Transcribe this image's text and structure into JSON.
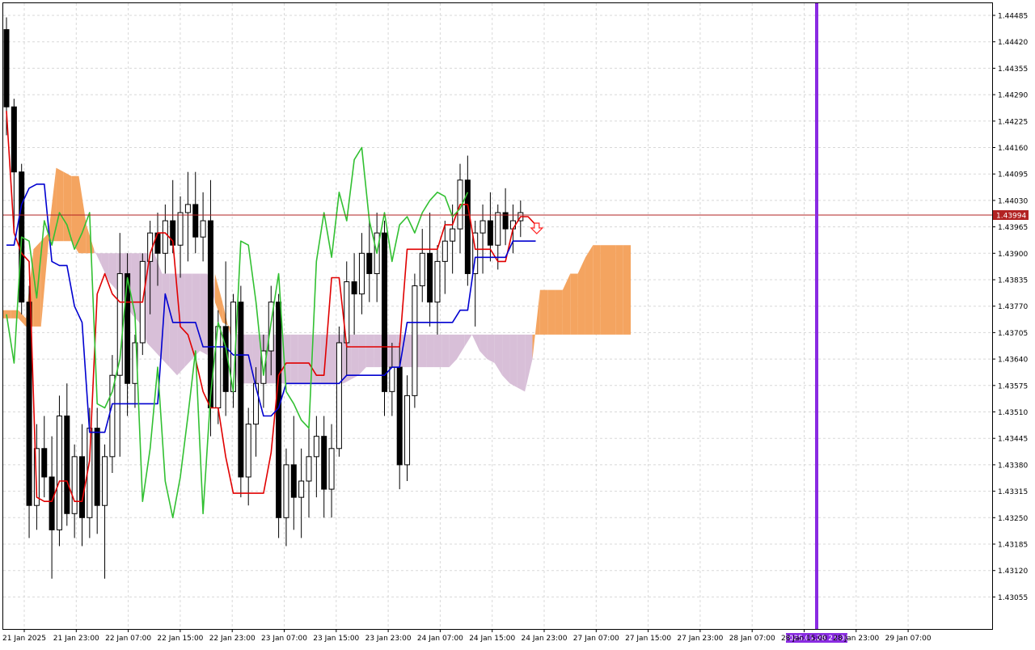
{
  "chart_data": {
    "type": "candlestick",
    "indicator": "Ichimoku Kinko Hyo",
    "y_ticks": [
      "1.44485",
      "1.44420",
      "1.44355",
      "1.44290",
      "1.44225",
      "1.44160",
      "1.44095",
      "1.44030",
      "1.43965",
      "1.43900",
      "1.43835",
      "1.43770",
      "1.43705",
      "1.43640",
      "1.43575",
      "1.43510",
      "1.43445",
      "1.43380",
      "1.43315",
      "1.43250",
      "1.43185",
      "1.43120",
      "1.43055"
    ],
    "ylim": [
      1.43004,
      1.44532
    ],
    "x_labels": [
      "21 Jan 2025",
      "21 Jan 23:00",
      "22 Jan 07:00",
      "22 Jan 15:00",
      "22 Jan 23:00",
      "23 Jan 07:00",
      "23 Jan 15:00",
      "23 Jan 23:00",
      "24 Jan 07:00",
      "24 Jan 15:00",
      "24 Jan 23:00",
      "27 Jan 07:00",
      "27 Jan 15:00",
      "27 Jan 23:00",
      "28 Jan 07:00",
      "28 Jan 15:00",
      "28 Jan 23:00",
      "29 Jan 07:00"
    ],
    "current_price": "1.43994",
    "current_price_value": 1.43994,
    "crosshair_time_label": "2025.01.28 21:00",
    "grid": true,
    "colors": {
      "bull_candle": "#ffffff",
      "bear_candle": "#000000",
      "tenkan_sen": "#e00000",
      "kijun_sen": "#0000d0",
      "chikou_span": "#32c032",
      "kumo_bullish": "#f4a460",
      "kumo_bearish": "#d8bfd8",
      "crosshair_line": "#8a2be2",
      "price_line": "#b22222",
      "sell_arrow": "#ff2020"
    },
    "series": [
      {
        "name": "Tenkan-sen",
        "values": [
          1.4425,
          1.4395,
          1.439,
          1.4388,
          1.433,
          1.4329,
          1.4329,
          1.4334,
          1.4334,
          1.4329,
          1.4329,
          1.4339,
          1.438,
          1.4385,
          1.438,
          1.4378,
          1.4378,
          1.4378,
          1.4378,
          1.439,
          1.4395,
          1.4395,
          1.4393,
          1.4372,
          1.437,
          1.4364,
          1.4356,
          1.4352,
          1.4352,
          1.434,
          1.4331,
          1.4331,
          1.4331,
          1.4331,
          1.4331,
          1.4341,
          1.436,
          1.4363,
          1.4363,
          1.4363,
          1.4363,
          1.436,
          1.436,
          1.4384,
          1.4384,
          1.4367,
          1.4367,
          1.4367,
          1.4367,
          1.4367,
          1.4367,
          1.4367,
          1.4367,
          1.4391,
          1.4391,
          1.4391,
          1.4391,
          1.4391,
          1.4397,
          1.4397,
          1.4402,
          1.4402,
          1.4391,
          1.4391,
          1.4391,
          1.4388,
          1.4388,
          1.4396,
          1.4399,
          1.4399,
          1.4397
        ]
      },
      {
        "name": "Kijun-sen",
        "values": [
          1.4392,
          1.4392,
          1.4402,
          1.4406,
          1.4407,
          1.4407,
          1.4388,
          1.4387,
          1.4387,
          1.4377,
          1.4373,
          1.4346,
          1.4346,
          1.4346,
          1.4353,
          1.4353,
          1.4353,
          1.4353,
          1.4353,
          1.4353,
          1.4353,
          1.438,
          1.4373,
          1.4373,
          1.4373,
          1.4373,
          1.4367,
          1.4367,
          1.4367,
          1.4367,
          1.4365,
          1.4365,
          1.4365,
          1.4357,
          1.435,
          1.435,
          1.4352,
          1.4358,
          1.4358,
          1.4358,
          1.4358,
          1.4358,
          1.4358,
          1.4358,
          1.4358,
          1.436,
          1.436,
          1.436,
          1.436,
          1.436,
          1.436,
          1.4362,
          1.4362,
          1.4373,
          1.4373,
          1.4373,
          1.4373,
          1.4373,
          1.4373,
          1.4373,
          1.4376,
          1.4376,
          1.4389,
          1.4389,
          1.4389,
          1.4389,
          1.4389,
          1.4393,
          1.4393,
          1.4393,
          1.4393
        ]
      },
      {
        "name": "Chikou Span",
        "values": [
          1.4375,
          1.4363,
          1.4394,
          1.4393,
          1.4379,
          1.4398,
          1.4392,
          1.44,
          1.4397,
          1.4391,
          1.4395,
          1.44,
          1.4353,
          1.4352,
          1.4356,
          1.4364,
          1.4384,
          1.4375,
          1.4329,
          1.4342,
          1.4362,
          1.4334,
          1.4325,
          1.4335,
          1.435,
          1.4366,
          1.4326,
          1.4355,
          1.4373,
          1.4367,
          1.4356,
          1.4393,
          1.4392,
          1.4378,
          1.436,
          1.4373,
          1.4385,
          1.4356,
          1.4353,
          1.4349,
          1.4347,
          1.4388,
          1.44,
          1.4389,
          1.4405,
          1.4398,
          1.4413,
          1.4416,
          1.4398,
          1.439,
          1.44,
          1.4388,
          1.4397,
          1.4399,
          1.4395,
          1.44,
          1.4403,
          1.4405,
          1.4404,
          1.4399,
          1.4401,
          1.4405
        ]
      },
      {
        "name": "Senkou Span A",
        "values": [
          1.4376,
          1.4376,
          1.4376,
          1.4374,
          1.4391,
          1.4393,
          1.4395,
          1.4411,
          1.441,
          1.4409,
          1.4409,
          1.4397,
          1.4391,
          1.4387,
          1.4383,
          1.4381,
          1.4378,
          1.4375,
          1.4373,
          1.4368,
          1.4366,
          1.4364,
          1.4362,
          1.436,
          1.4362,
          1.4364,
          1.4366,
          1.4365,
          1.4385,
          1.4378,
          1.437,
          1.4358,
          1.4358,
          1.4358,
          1.4358,
          1.4358,
          1.4358,
          1.4358,
          1.4358,
          1.4358,
          1.4358,
          1.4358,
          1.4358,
          1.4358,
          1.4358,
          1.4358,
          1.4359,
          1.436,
          1.4362,
          1.4362,
          1.4362,
          1.4362,
          1.4362,
          1.4362,
          1.4362,
          1.4362,
          1.4362,
          1.4362,
          1.4362,
          1.4362,
          1.4364,
          1.4367,
          1.437,
          1.4366,
          1.4364,
          1.4363,
          1.436,
          1.4358,
          1.4357,
          1.4356,
          1.4364,
          1.4381,
          1.4381,
          1.4381,
          1.4381,
          1.4385,
          1.4385,
          1.4389,
          1.4392,
          1.4392,
          1.4392,
          1.4392,
          1.4392,
          1.4392
        ]
      },
      {
        "name": "Senkou Span B",
        "values": [
          1.4374,
          1.4374,
          1.4374,
          1.4372,
          1.4372,
          1.4372,
          1.4393,
          1.4393,
          1.4393,
          1.4393,
          1.439,
          1.439,
          1.439,
          1.439,
          1.439,
          1.439,
          1.439,
          1.439,
          1.439,
          1.439,
          1.439,
          1.4385,
          1.4385,
          1.4385,
          1.4385,
          1.4385,
          1.4385,
          1.4385,
          1.4378,
          1.4373,
          1.4372,
          1.437,
          1.437,
          1.437,
          1.437,
          1.437,
          1.437,
          1.437,
          1.437,
          1.437,
          1.437,
          1.437,
          1.437,
          1.437,
          1.437,
          1.437,
          1.437,
          1.437,
          1.437,
          1.437,
          1.437,
          1.437,
          1.437,
          1.437,
          1.437,
          1.437,
          1.437,
          1.437,
          1.437,
          1.437,
          1.437,
          1.437,
          1.437,
          1.437,
          1.437,
          1.437,
          1.437,
          1.437,
          1.437,
          1.437,
          1.437,
          1.437,
          1.437,
          1.437,
          1.437,
          1.437,
          1.437,
          1.437,
          1.437,
          1.437,
          1.437,
          1.437,
          1.437,
          1.437
        ]
      }
    ],
    "candles": [
      {
        "o": 1.4445,
        "h": 1.4448,
        "l": 1.4419,
        "c": 1.4426
      },
      {
        "o": 1.4426,
        "h": 1.4428,
        "l": 1.4395,
        "c": 1.441
      },
      {
        "o": 1.441,
        "h": 1.4412,
        "l": 1.4375,
        "c": 1.4378
      },
      {
        "o": 1.4378,
        "h": 1.4382,
        "l": 1.432,
        "c": 1.4328
      },
      {
        "o": 1.4328,
        "h": 1.4348,
        "l": 1.4322,
        "c": 1.4342
      },
      {
        "o": 1.4342,
        "h": 1.435,
        "l": 1.433,
        "c": 1.4335
      },
      {
        "o": 1.4335,
        "h": 1.4345,
        "l": 1.431,
        "c": 1.4322
      },
      {
        "o": 1.4322,
        "h": 1.4355,
        "l": 1.4318,
        "c": 1.435
      },
      {
        "o": 1.435,
        "h": 1.4358,
        "l": 1.4323,
        "c": 1.4326
      },
      {
        "o": 1.4326,
        "h": 1.4343,
        "l": 1.432,
        "c": 1.434
      },
      {
        "o": 1.434,
        "h": 1.4348,
        "l": 1.4318,
        "c": 1.4325
      },
      {
        "o": 1.4325,
        "h": 1.4352,
        "l": 1.432,
        "c": 1.4347
      },
      {
        "o": 1.4347,
        "h": 1.4352,
        "l": 1.4321,
        "c": 1.4328
      },
      {
        "o": 1.4328,
        "h": 1.4343,
        "l": 1.431,
        "c": 1.434
      },
      {
        "o": 1.434,
        "h": 1.4365,
        "l": 1.4336,
        "c": 1.436
      },
      {
        "o": 1.436,
        "h": 1.4395,
        "l": 1.434,
        "c": 1.4385
      },
      {
        "o": 1.4385,
        "h": 1.439,
        "l": 1.435,
        "c": 1.4358
      },
      {
        "o": 1.4358,
        "h": 1.437,
        "l": 1.4352,
        "c": 1.4368
      },
      {
        "o": 1.4368,
        "h": 1.439,
        "l": 1.4365,
        "c": 1.4388
      },
      {
        "o": 1.4388,
        "h": 1.4398,
        "l": 1.4375,
        "c": 1.4395
      },
      {
        "o": 1.4395,
        "h": 1.44,
        "l": 1.4382,
        "c": 1.439
      },
      {
        "o": 1.439,
        "h": 1.4402,
        "l": 1.4385,
        "c": 1.4398
      },
      {
        "o": 1.4398,
        "h": 1.4408,
        "l": 1.439,
        "c": 1.4392
      },
      {
        "o": 1.4392,
        "h": 1.4404,
        "l": 1.4384,
        "c": 1.44
      },
      {
        "o": 1.44,
        "h": 1.441,
        "l": 1.4388,
        "c": 1.4402
      },
      {
        "o": 1.4402,
        "h": 1.441,
        "l": 1.439,
        "c": 1.4394
      },
      {
        "o": 1.4394,
        "h": 1.4405,
        "l": 1.4388,
        "c": 1.4398
      },
      {
        "o": 1.4398,
        "h": 1.4408,
        "l": 1.4345,
        "c": 1.4352
      },
      {
        "o": 1.4352,
        "h": 1.4376,
        "l": 1.4348,
        "c": 1.4372
      },
      {
        "o": 1.4372,
        "h": 1.4388,
        "l": 1.435,
        "c": 1.4356
      },
      {
        "o": 1.4356,
        "h": 1.438,
        "l": 1.4352,
        "c": 1.4378
      },
      {
        "o": 1.4378,
        "h": 1.4382,
        "l": 1.433,
        "c": 1.4335
      },
      {
        "o": 1.4335,
        "h": 1.4352,
        "l": 1.4328,
        "c": 1.4348
      },
      {
        "o": 1.4348,
        "h": 1.4362,
        "l": 1.434,
        "c": 1.4358
      },
      {
        "o": 1.4358,
        "h": 1.437,
        "l": 1.4352,
        "c": 1.4366
      },
      {
        "o": 1.4366,
        "h": 1.4382,
        "l": 1.436,
        "c": 1.4378
      },
      {
        "o": 1.4378,
        "h": 1.438,
        "l": 1.432,
        "c": 1.4325
      },
      {
        "o": 1.4325,
        "h": 1.4342,
        "l": 1.4318,
        "c": 1.4338
      },
      {
        "o": 1.4338,
        "h": 1.435,
        "l": 1.4322,
        "c": 1.433
      },
      {
        "o": 1.433,
        "h": 1.4342,
        "l": 1.432,
        "c": 1.4334
      },
      {
        "o": 1.4334,
        "h": 1.4348,
        "l": 1.4325,
        "c": 1.434
      },
      {
        "o": 1.434,
        "h": 1.435,
        "l": 1.433,
        "c": 1.4345
      },
      {
        "o": 1.4345,
        "h": 1.435,
        "l": 1.4325,
        "c": 1.4332
      },
      {
        "o": 1.4332,
        "h": 1.4348,
        "l": 1.4325,
        "c": 1.4342
      },
      {
        "o": 1.4342,
        "h": 1.4372,
        "l": 1.434,
        "c": 1.4368
      },
      {
        "o": 1.4368,
        "h": 1.4388,
        "l": 1.436,
        "c": 1.4383
      },
      {
        "o": 1.4383,
        "h": 1.439,
        "l": 1.437,
        "c": 1.438
      },
      {
        "o": 1.438,
        "h": 1.4395,
        "l": 1.4375,
        "c": 1.439
      },
      {
        "o": 1.439,
        "h": 1.4398,
        "l": 1.4378,
        "c": 1.4385
      },
      {
        "o": 1.4385,
        "h": 1.44,
        "l": 1.4378,
        "c": 1.4395
      },
      {
        "o": 1.4395,
        "h": 1.4398,
        "l": 1.435,
        "c": 1.4356
      },
      {
        "o": 1.4356,
        "h": 1.4368,
        "l": 1.435,
        "c": 1.4362
      },
      {
        "o": 1.4362,
        "h": 1.4368,
        "l": 1.4332,
        "c": 1.4338
      },
      {
        "o": 1.4338,
        "h": 1.436,
        "l": 1.4334,
        "c": 1.4355
      },
      {
        "o": 1.4355,
        "h": 1.4385,
        "l": 1.4352,
        "c": 1.4382
      },
      {
        "o": 1.4382,
        "h": 1.4396,
        "l": 1.4378,
        "c": 1.439
      },
      {
        "o": 1.439,
        "h": 1.44,
        "l": 1.4372,
        "c": 1.4378
      },
      {
        "o": 1.4378,
        "h": 1.4392,
        "l": 1.437,
        "c": 1.4388
      },
      {
        "o": 1.4388,
        "h": 1.4398,
        "l": 1.438,
        "c": 1.4393
      },
      {
        "o": 1.4393,
        "h": 1.4402,
        "l": 1.4385,
        "c": 1.4396
      },
      {
        "o": 1.4396,
        "h": 1.4412,
        "l": 1.439,
        "c": 1.4408
      },
      {
        "o": 1.4408,
        "h": 1.4414,
        "l": 1.4382,
        "c": 1.4385
      },
      {
        "o": 1.4385,
        "h": 1.4398,
        "l": 1.4372,
        "c": 1.4395
      },
      {
        "o": 1.4395,
        "h": 1.4402,
        "l": 1.4385,
        "c": 1.4398
      },
      {
        "o": 1.4398,
        "h": 1.4405,
        "l": 1.4388,
        "c": 1.4392
      },
      {
        "o": 1.4392,
        "h": 1.4402,
        "l": 1.4386,
        "c": 1.44
      },
      {
        "o": 1.44,
        "h": 1.4406,
        "l": 1.4392,
        "c": 1.4396
      },
      {
        "o": 1.4396,
        "h": 1.4402,
        "l": 1.439,
        "c": 1.4398
      },
      {
        "o": 1.4398,
        "h": 1.4403,
        "l": 1.4394,
        "c": 1.44
      }
    ]
  }
}
